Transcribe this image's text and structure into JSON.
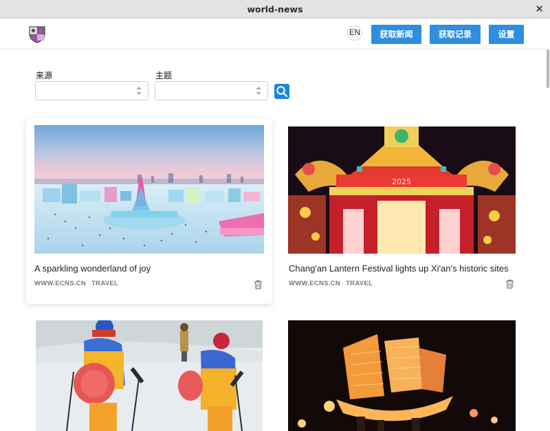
{
  "window": {
    "title": "world-news"
  },
  "header": {
    "lang": "EN",
    "buttons": {
      "fetch_news": "获取新闻",
      "fetch_log": "获取记录",
      "settings": "设置"
    }
  },
  "filters": {
    "source_label": "来源",
    "source_value": "",
    "topic_label": "主题",
    "topic_value": ""
  },
  "articles": [
    {
      "title": "A sparkling wonderland of joy",
      "source": "WWW.ECNS.CN",
      "tag": "TRAVEL"
    },
    {
      "title": "Chang'an Lantern Festival lights up Xi'an's historic sites",
      "source": "WWW.ECNS.CN",
      "tag": "TRAVEL"
    },
    {
      "title": "",
      "source": "",
      "tag": ""
    },
    {
      "title": "",
      "source": "",
      "tag": ""
    }
  ],
  "colors": {
    "accent": "#2f8ee0",
    "search": "#1e86d9"
  },
  "icons": {
    "logo": "shield-logo-icon",
    "select": "select-arrows-icon",
    "search": "search-icon",
    "delete": "trash-icon",
    "close": "close-icon"
  }
}
